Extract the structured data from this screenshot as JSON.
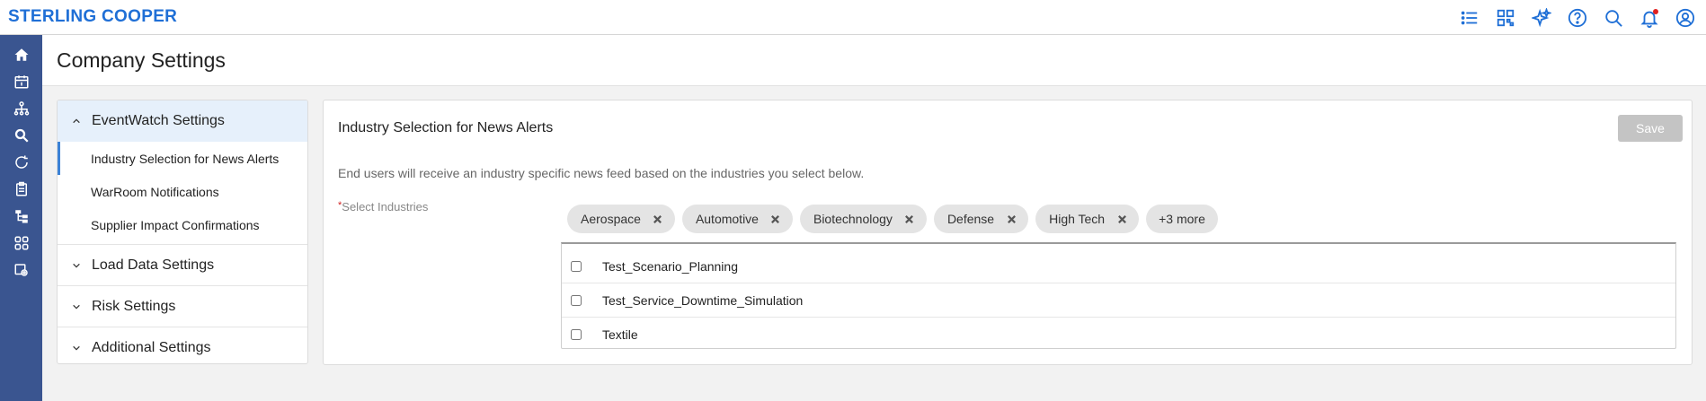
{
  "app": {
    "brand": "STERLING COOPER"
  },
  "header_icons": [
    "list-icon",
    "dashboard-icon",
    "sparkle-icon",
    "help-icon",
    "search-icon",
    "bell-icon",
    "user-icon"
  ],
  "rail_icons": [
    "home-icon",
    "calendar-icon",
    "network-icon",
    "search-icon",
    "refresh-icon",
    "clipboard-icon",
    "hierarchy-icon",
    "apps-icon",
    "settings-gear-icon"
  ],
  "page": {
    "title": "Company Settings"
  },
  "nav": {
    "sections": [
      {
        "label": "EventWatch Settings",
        "expanded": true,
        "items": [
          "Industry Selection for News Alerts",
          "WarRoom Notifications",
          "Supplier Impact Confirmations"
        ]
      },
      {
        "label": "Load Data Settings",
        "expanded": false
      },
      {
        "label": "Risk Settings",
        "expanded": false
      },
      {
        "label": "Additional Settings",
        "expanded": false
      }
    ]
  },
  "panel": {
    "title": "Industry Selection for News Alerts",
    "save_label": "Save",
    "description": "End users will receive an industry specific news feed based on the industries you select below.",
    "field_required_mark": "*",
    "field_label": "Select Industries",
    "selected_chips": [
      "Aerospace",
      "Automotive",
      "Biotechnology",
      "Defense",
      "High Tech"
    ],
    "more_label": "+3 more",
    "options": [
      {
        "label": "Test_Scenario_Planning",
        "checked": false
      },
      {
        "label": "Test_Service_Downtime_Simulation",
        "checked": false
      },
      {
        "label": "Textile",
        "checked": false
      }
    ]
  },
  "colors": {
    "brand": "#1f6fd6",
    "rail": "#3a5590",
    "active_section": "#e6f0fb",
    "active_border": "#3b82d6",
    "save_disabled": "#c4c4c4",
    "notification": "#e02020"
  }
}
